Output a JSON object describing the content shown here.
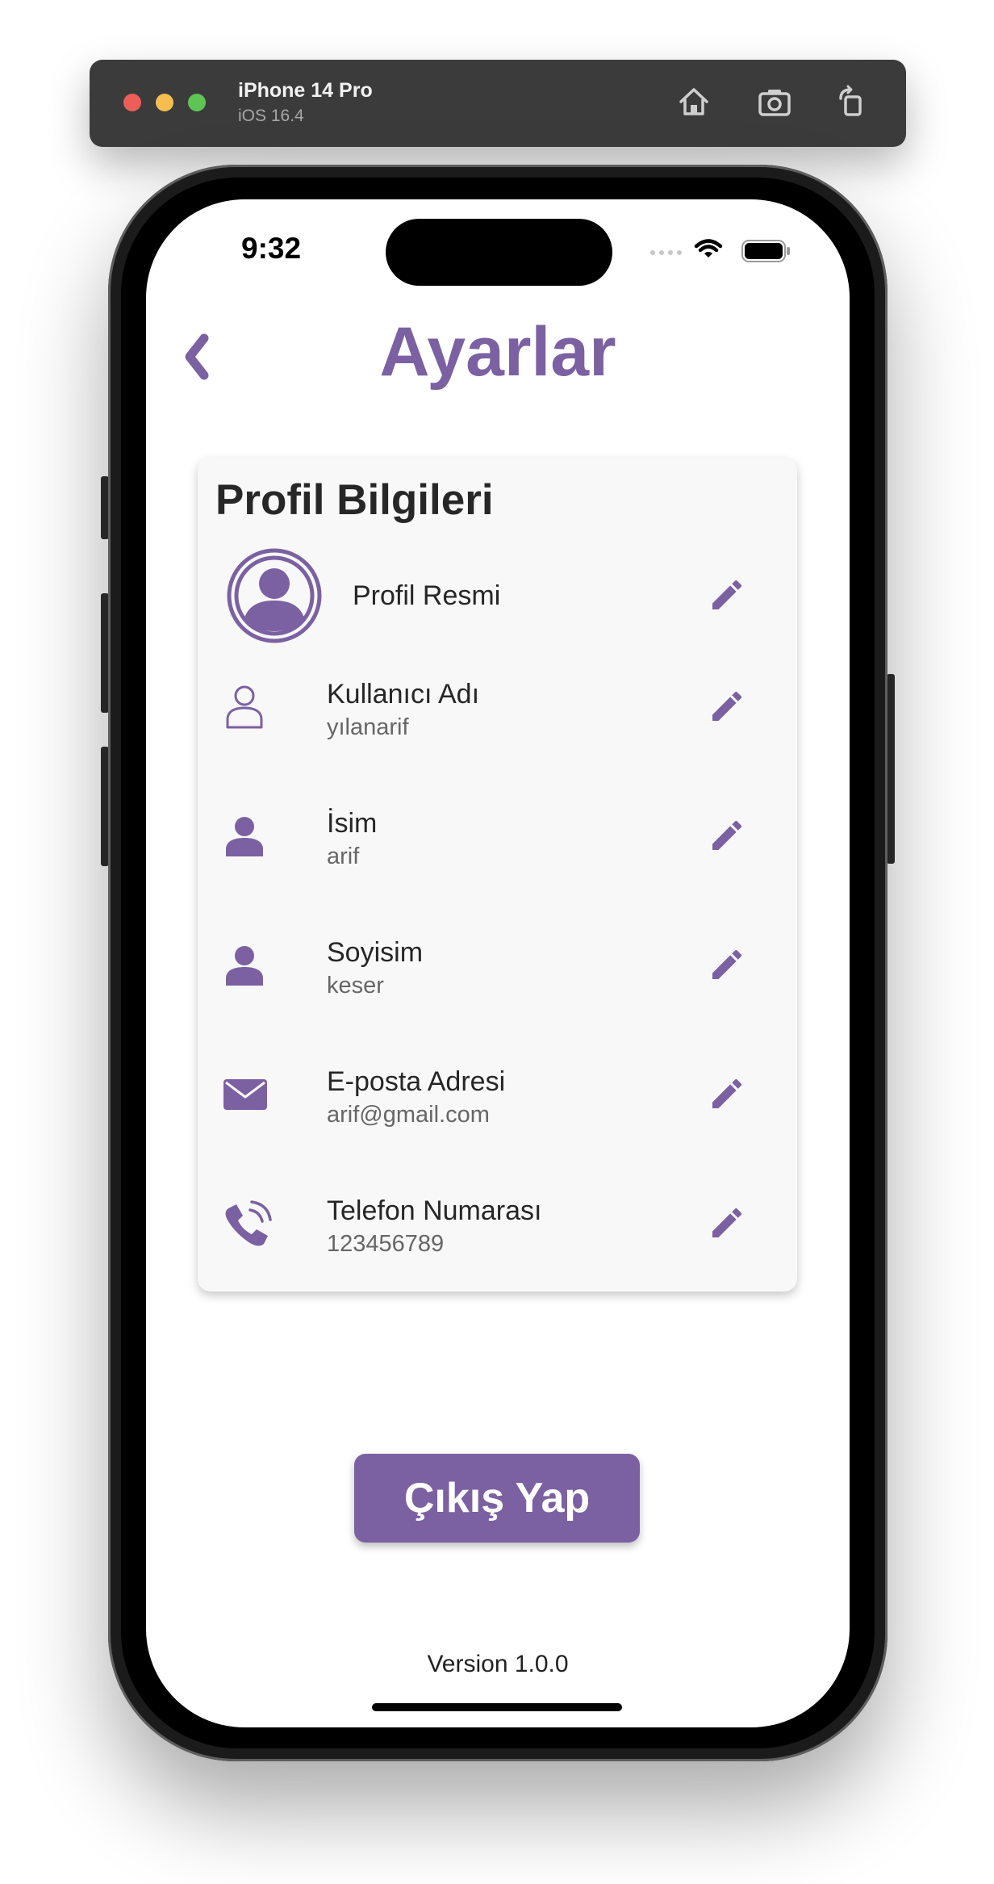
{
  "simulator": {
    "device_name": "iPhone 14 Pro",
    "os_version": "iOS 16.4",
    "traffic_lights": [
      "#ec5f59",
      "#f5be4f",
      "#5ec454"
    ]
  },
  "status_bar": {
    "time": "9:32"
  },
  "header": {
    "title": "Ayarlar",
    "back_icon": "chevron-left-icon"
  },
  "profile_card": {
    "title": "Profil Bilgileri",
    "avatar_label": "Profil Resmi",
    "items": [
      {
        "icon": "user-outline-icon",
        "label": "Kullanıcı Adı",
        "value": "yılanarif"
      },
      {
        "icon": "person-icon",
        "label": "İsim",
        "value": "arif"
      },
      {
        "icon": "person-icon",
        "label": "Soyisim",
        "value": "keser"
      },
      {
        "icon": "envelope-icon",
        "label": "E-posta Adresi",
        "value": "arif@gmail.com"
      },
      {
        "icon": "phone-icon",
        "label": "Telefon Numarası",
        "value": "123456789"
      }
    ]
  },
  "logout_button": {
    "label": "Çıkış Yap"
  },
  "footer": {
    "version": "Version 1.0.0"
  },
  "colors": {
    "accent": "#7b61a1",
    "card_bg": "#f8f8f8",
    "sim_bar": "#3b3b3b"
  }
}
